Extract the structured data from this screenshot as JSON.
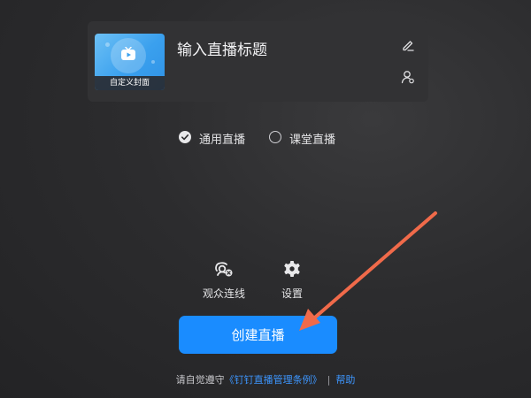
{
  "card": {
    "cover_label": "自定义封面",
    "title": "输入直播标题",
    "edit_icon": "pencil-icon",
    "user_icon": "user-settings-icon"
  },
  "modes": [
    {
      "label": "通用直播",
      "selected": true
    },
    {
      "label": "课堂直播",
      "selected": false
    }
  ],
  "tools": [
    {
      "label": "观众连线",
      "icon": "audience-connect-icon"
    },
    {
      "label": "设置",
      "icon": "gear-icon"
    }
  ],
  "create_button": "创建直播",
  "footer": {
    "prefix": "请自觉遵守",
    "rules_link": "《钉钉直播管理条例》",
    "separator": "|",
    "help_link": "帮助"
  },
  "colors": {
    "primary": "#1a8cff",
    "link": "#3d96ff",
    "annotation_arrow": "#f06a4a"
  }
}
